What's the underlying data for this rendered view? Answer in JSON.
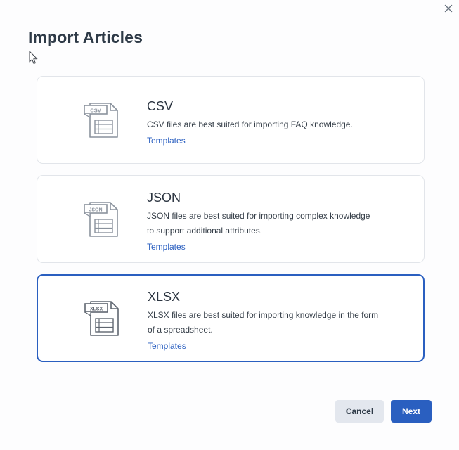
{
  "dialog": {
    "title": "Import Articles",
    "close_icon": "close-icon"
  },
  "options": [
    {
      "name": "CSV",
      "badge": "CSV",
      "description_lines": [
        "CSV files are best suited for importing FAQ knowledge."
      ],
      "link": "Templates",
      "selected": false
    },
    {
      "name": "JSON",
      "badge": "JSON",
      "description_lines": [
        "JSON files are best suited for importing complex knowledge",
        "to support additional attributes."
      ],
      "link": "Templates",
      "selected": false
    },
    {
      "name": "XLSX",
      "badge": "XLSX",
      "description_lines": [
        "XLSX files are best suited for importing knowledge in the form",
        "of a spreadsheet."
      ],
      "link": "Templates",
      "selected": true
    }
  ],
  "footer": {
    "cancel_label": "Cancel",
    "next_label": "Next"
  },
  "colors": {
    "accent": "#2a5fc0",
    "icon_stroke": "#8a929d",
    "border": "#e2e5ea"
  }
}
